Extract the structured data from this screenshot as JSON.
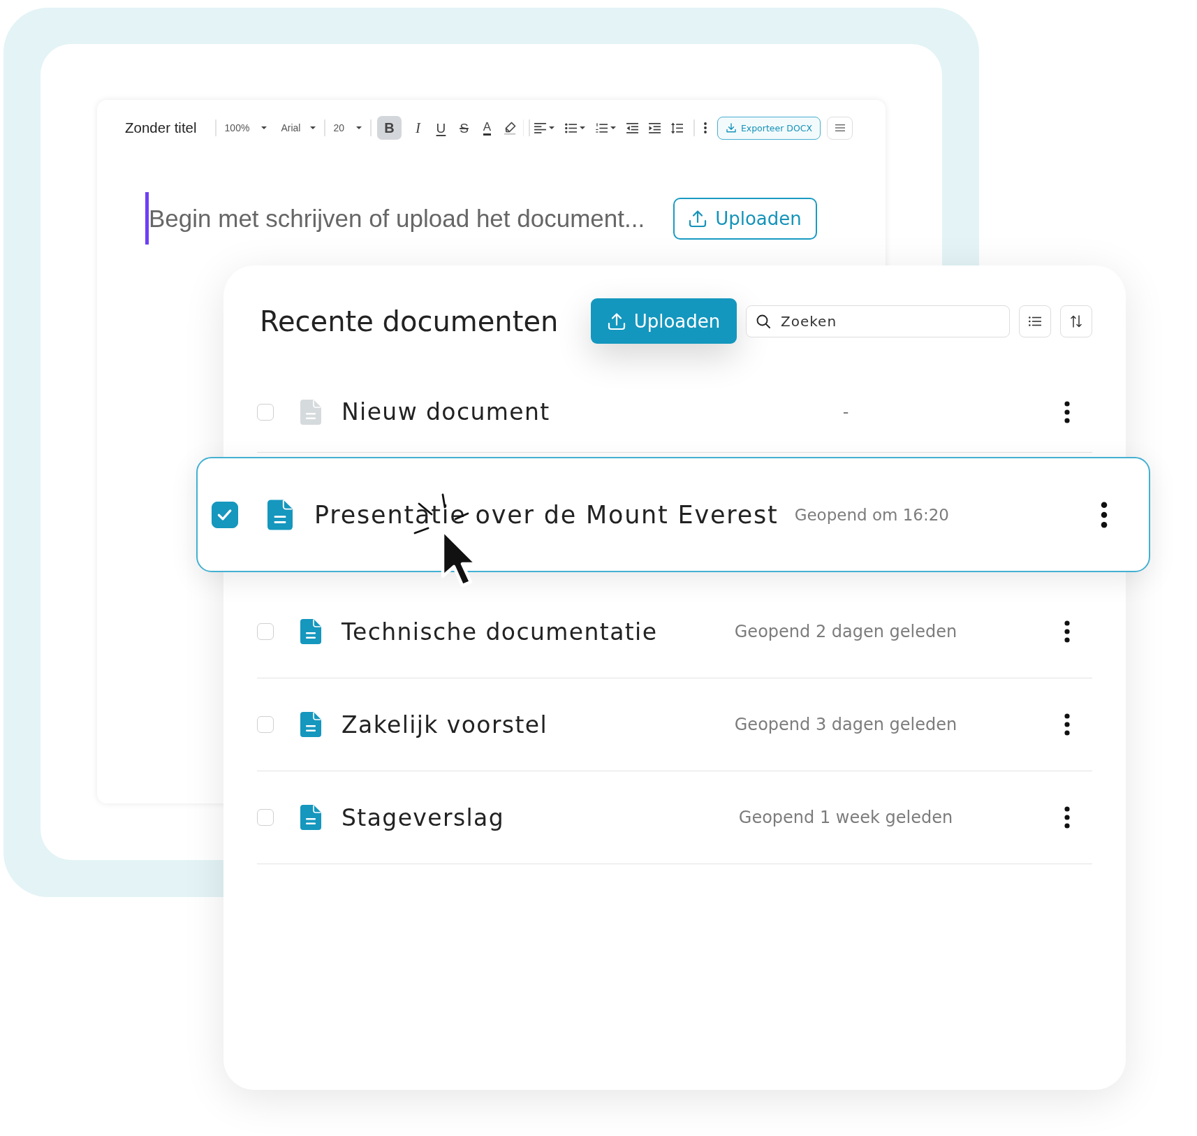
{
  "editor": {
    "title": "Zonder titel",
    "zoom": "100%",
    "font": "Arial",
    "font_size": "20",
    "formatting": [
      {
        "kind": "bold",
        "glyph": "B",
        "on": true
      },
      {
        "kind": "italic",
        "glyph": "I",
        "on": false
      },
      {
        "kind": "underline",
        "glyph": "U",
        "on": false
      },
      {
        "kind": "strike",
        "glyph": "S",
        "on": false
      },
      {
        "kind": "text_color",
        "glyph": "A",
        "on": false
      },
      {
        "kind": "highlight",
        "on": false
      }
    ],
    "export_button": "Exporteer DOCX",
    "placeholder": "Begin met schrijven of upload het document...",
    "upload_button": "Uploaden"
  },
  "recent": {
    "title": "Recente documenten",
    "upload_button": "Uploaden",
    "search": {
      "placeholder": "Zoeken"
    },
    "documents": [
      {
        "kind": "blank",
        "name": "Nieuw document",
        "opened": "-",
        "checked": false,
        "selected": false
      },
      {
        "kind": "document",
        "name": "Presentatie over de Mount Everest",
        "opened": "Geopend om 16:20",
        "checked": true,
        "selected": true
      },
      {
        "kind": "document",
        "name": "Technische documentatie",
        "opened": "Geopend 2 dagen geleden",
        "checked": false,
        "selected": false
      },
      {
        "kind": "document",
        "name": "Zakelijk voorstel",
        "opened": "Geopend 3 dagen geleden",
        "checked": false,
        "selected": false
      },
      {
        "kind": "document",
        "name": "Stageverslag",
        "opened": "Geopend 1 week geleden",
        "checked": false,
        "selected": false
      }
    ]
  }
}
